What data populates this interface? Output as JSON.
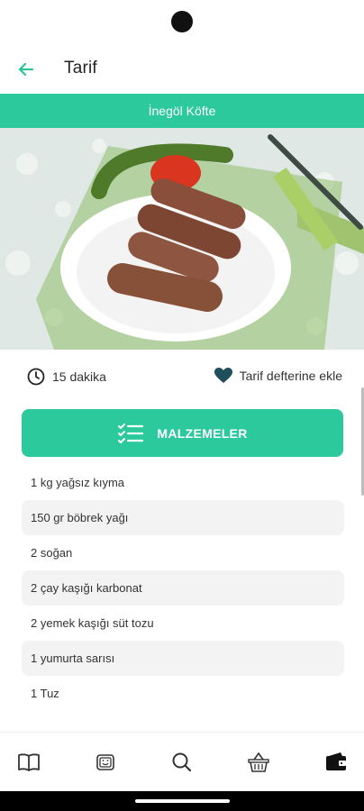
{
  "header": {
    "title": "Tarif",
    "back_icon": "arrow-left-icon"
  },
  "recipe": {
    "name": "İnegöl Köfte",
    "time": "15 dakika",
    "save_label": "Tarif defterine ekle"
  },
  "ingredients": {
    "button_label": "MALZEMELER",
    "items": [
      "1 kg yağsız kıyma",
      "150 gr böbrek yağı",
      "2 soğan",
      "2 çay kaşığı karbonat",
      "2 yemek kaşığı süt tozu",
      "1 yumurta sarısı",
      "1 Tuz"
    ]
  },
  "bottom_nav": {
    "items": [
      "book-icon",
      "tv-icon",
      "search-icon",
      "basket-icon",
      "wallet-icon"
    ]
  },
  "colors": {
    "accent": "#2cc99c",
    "heart": "#1f4f5a",
    "row_alt": "#f3f3f3"
  }
}
